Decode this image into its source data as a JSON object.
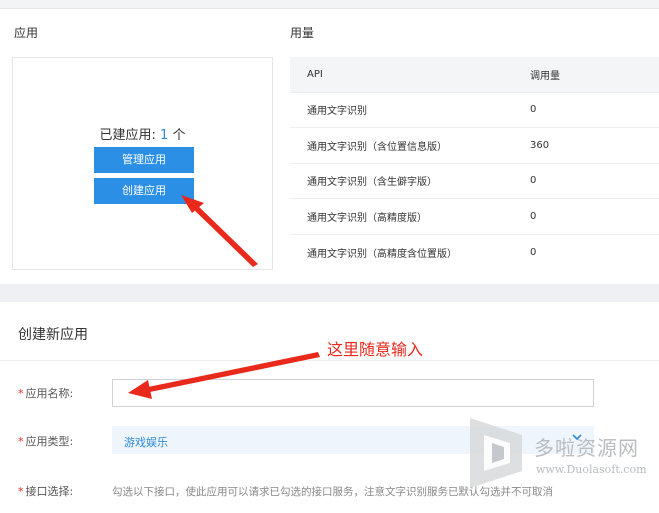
{
  "app_section": {
    "title": "应用",
    "count_label": "已建应用:",
    "count_value": "1",
    "count_unit": "个",
    "manage_button": "管理应用",
    "create_button": "创建应用"
  },
  "usage_section": {
    "title": "用量",
    "columns": [
      "API",
      "调用量"
    ],
    "rows": [
      {
        "api": "通用文字识别",
        "calls": "0"
      },
      {
        "api": "通用文字识别（含位置信息版）",
        "calls": "360"
      },
      {
        "api": "通用文字识别（含生僻字版）",
        "calls": "0"
      },
      {
        "api": "通用文字识别（高精度版）",
        "calls": "0"
      },
      {
        "api": "通用文字识别（高精度含位置版）",
        "calls": "0"
      }
    ]
  },
  "create_form": {
    "title": "创建新应用",
    "annotation": "这里随意输入",
    "required_mark": "*",
    "name_label": "应用名称:",
    "name_value": "",
    "type_label": "应用类型:",
    "type_value": "游戏娱乐",
    "api_label": "接口选择:",
    "api_description": "勾选以下接口，使此应用可以请求已勾选的接口服务，注意文字识别服务已默认勾选并不可取消"
  },
  "watermark": {
    "text": "多啦资源网",
    "url": "www.Duolasoft.com"
  },
  "colors": {
    "primary_blue": "#2b8fe6",
    "annotation_red": "#e8291c",
    "select_bg": "#eef5fd"
  }
}
